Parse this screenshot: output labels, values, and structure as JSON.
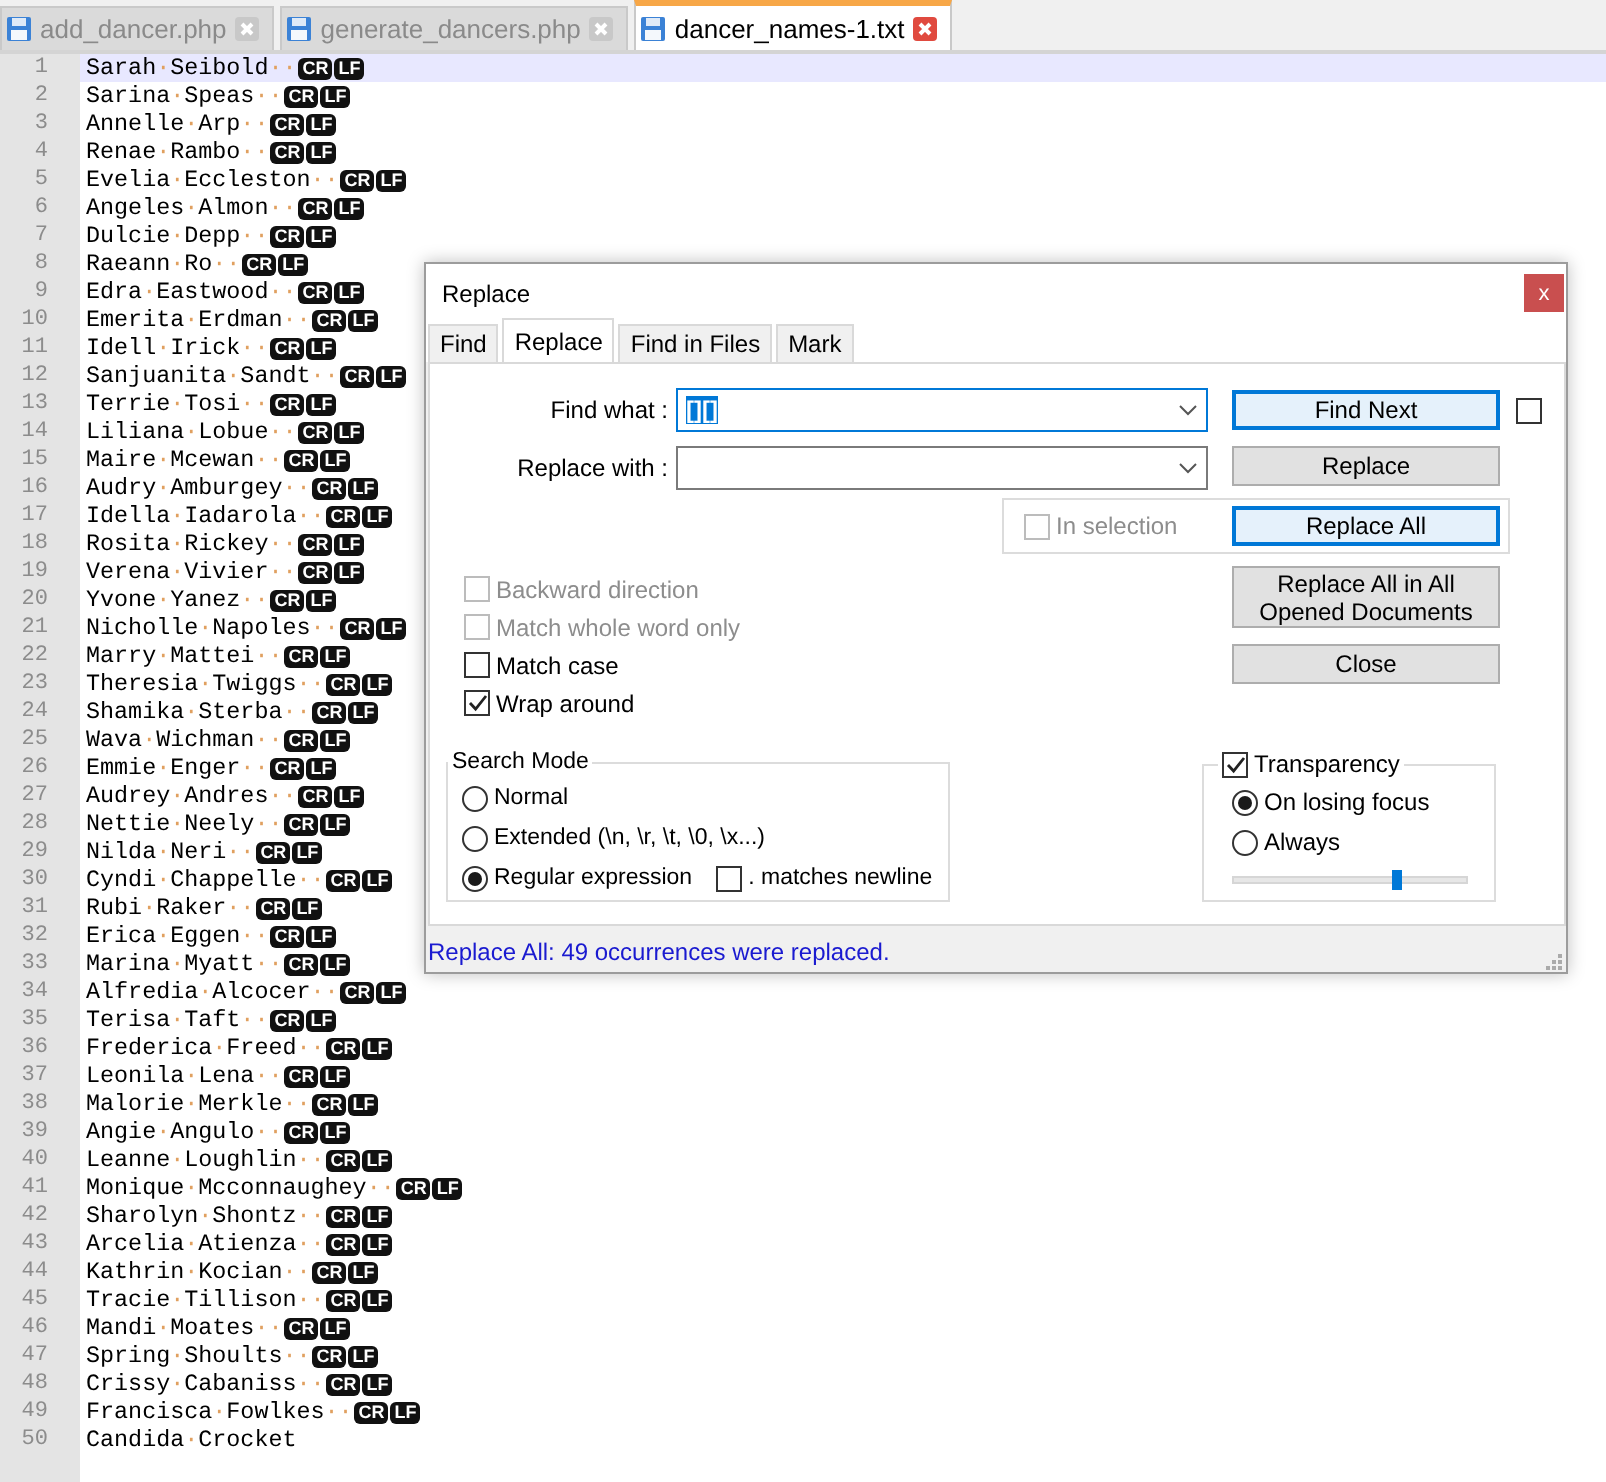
{
  "file_tabs": [
    {
      "label": "add_dancer.php",
      "selected": false
    },
    {
      "label": "generate_dancers.php",
      "selected": false
    },
    {
      "label": "dancer_names-1.txt",
      "selected": true
    }
  ],
  "editor": {
    "lines": [
      {
        "number": "1",
        "text": "Sarah·Seibold··",
        "eol": [
          "CR",
          "LF"
        ],
        "current": true
      },
      {
        "number": "2",
        "text": "Sarina·Speas··",
        "eol": [
          "CR",
          "LF"
        ],
        "current": false
      },
      {
        "number": "3",
        "text": "Annelle·Arp··",
        "eol": [
          "CR",
          "LF"
        ],
        "current": false
      },
      {
        "number": "4",
        "text": "Renae·Rambo··",
        "eol": [
          "CR",
          "LF"
        ],
        "current": false
      },
      {
        "number": "5",
        "text": "Evelia·Eccleston··",
        "eol": [
          "CR",
          "LF"
        ],
        "current": false
      },
      {
        "number": "6",
        "text": "Angeles·Almon··",
        "eol": [
          "CR",
          "LF"
        ],
        "current": false
      },
      {
        "number": "7",
        "text": "Dulcie·Depp··",
        "eol": [
          "CR",
          "LF"
        ],
        "current": false
      },
      {
        "number": "8",
        "text": "Raeann·Ro··",
        "eol": [
          "CR",
          "LF"
        ],
        "current": false
      },
      {
        "number": "9",
        "text": "Edra·Eastwood··",
        "eol": [
          "CR",
          "LF"
        ],
        "current": false
      },
      {
        "number": "10",
        "text": "Emerita·Erdman··",
        "eol": [
          "CR",
          "LF"
        ],
        "current": false
      },
      {
        "number": "11",
        "text": "Idell·Irick··",
        "eol": [
          "CR",
          "LF"
        ],
        "current": false
      },
      {
        "number": "12",
        "text": "Sanjuanita·Sandt··",
        "eol": [
          "CR",
          "LF"
        ],
        "current": false
      },
      {
        "number": "13",
        "text": "Terrie·Tosi··",
        "eol": [
          "CR",
          "LF"
        ],
        "current": false
      },
      {
        "number": "14",
        "text": "Liliana·Lobue··",
        "eol": [
          "CR",
          "LF"
        ],
        "current": false
      },
      {
        "number": "15",
        "text": "Maire·Mcewan··",
        "eol": [
          "CR",
          "LF"
        ],
        "current": false
      },
      {
        "number": "16",
        "text": "Audry·Amburgey··",
        "eol": [
          "CR",
          "LF"
        ],
        "current": false
      },
      {
        "number": "17",
        "text": "Idella·Iadarola··",
        "eol": [
          "CR",
          "LF"
        ],
        "current": false
      },
      {
        "number": "18",
        "text": "Rosita·Rickey··",
        "eol": [
          "CR",
          "LF"
        ],
        "current": false
      },
      {
        "number": "19",
        "text": "Verena·Vivier··",
        "eol": [
          "CR",
          "LF"
        ],
        "current": false
      },
      {
        "number": "20",
        "text": "Yvone·Yanez··",
        "eol": [
          "CR",
          "LF"
        ],
        "current": false
      },
      {
        "number": "21",
        "text": "Nicholle·Napoles··",
        "eol": [
          "CR",
          "LF"
        ],
        "current": false
      },
      {
        "number": "22",
        "text": "Marry·Mattei··",
        "eol": [
          "CR",
          "LF"
        ],
        "current": false
      },
      {
        "number": "23",
        "text": "Theresia·Twiggs··",
        "eol": [
          "CR",
          "LF"
        ],
        "current": false
      },
      {
        "number": "24",
        "text": "Shamika·Sterba··",
        "eol": [
          "CR",
          "LF"
        ],
        "current": false
      },
      {
        "number": "25",
        "text": "Wava·Wichman··",
        "eol": [
          "CR",
          "LF"
        ],
        "current": false
      },
      {
        "number": "26",
        "text": "Emmie·Enger··",
        "eol": [
          "CR",
          "LF"
        ],
        "current": false
      },
      {
        "number": "27",
        "text": "Audrey·Andres··",
        "eol": [
          "CR",
          "LF"
        ],
        "current": false
      },
      {
        "number": "28",
        "text": "Nettie·Neely··",
        "eol": [
          "CR",
          "LF"
        ],
        "current": false
      },
      {
        "number": "29",
        "text": "Nilda·Neri··",
        "eol": [
          "CR",
          "LF"
        ],
        "current": false
      },
      {
        "number": "30",
        "text": "Cyndi·Chappelle··",
        "eol": [
          "CR",
          "LF"
        ],
        "current": false
      },
      {
        "number": "31",
        "text": "Rubi·Raker··",
        "eol": [
          "CR",
          "LF"
        ],
        "current": false
      },
      {
        "number": "32",
        "text": "Erica·Eggen··",
        "eol": [
          "CR",
          "LF"
        ],
        "current": false
      },
      {
        "number": "33",
        "text": "Marina·Myatt··",
        "eol": [
          "CR",
          "LF"
        ],
        "current": false
      },
      {
        "number": "34",
        "text": "Alfredia·Alcocer··",
        "eol": [
          "CR",
          "LF"
        ],
        "current": false
      },
      {
        "number": "35",
        "text": "Terisa·Taft··",
        "eol": [
          "CR",
          "LF"
        ],
        "current": false
      },
      {
        "number": "36",
        "text": "Frederica·Freed··",
        "eol": [
          "CR",
          "LF"
        ],
        "current": false
      },
      {
        "number": "37",
        "text": "Leonila·Lena··",
        "eol": [
          "CR",
          "LF"
        ],
        "current": false
      },
      {
        "number": "38",
        "text": "Malorie·Merkle··",
        "eol": [
          "CR",
          "LF"
        ],
        "current": false
      },
      {
        "number": "39",
        "text": "Angie·Angulo··",
        "eol": [
          "CR",
          "LF"
        ],
        "current": false
      },
      {
        "number": "40",
        "text": "Leanne·Loughlin··",
        "eol": [
          "CR",
          "LF"
        ],
        "current": false
      },
      {
        "number": "41",
        "text": "Monique·Mcconnaughey··",
        "eol": [
          "CR",
          "LF"
        ],
        "current": false
      },
      {
        "number": "42",
        "text": "Sharolyn·Shontz··",
        "eol": [
          "CR",
          "LF"
        ],
        "current": false
      },
      {
        "number": "43",
        "text": "Arcelia·Atienza··",
        "eol": [
          "CR",
          "LF"
        ],
        "current": false
      },
      {
        "number": "44",
        "text": "Kathrin·Kocian··",
        "eol": [
          "CR",
          "LF"
        ],
        "current": false
      },
      {
        "number": "45",
        "text": "Tracie·Tillison··",
        "eol": [
          "CR",
          "LF"
        ],
        "current": false
      },
      {
        "number": "46",
        "text": "Mandi·Moates··",
        "eol": [
          "CR",
          "LF"
        ],
        "current": false
      },
      {
        "number": "47",
        "text": "Spring·Shoults··",
        "eol": [
          "CR",
          "LF"
        ],
        "current": false
      },
      {
        "number": "48",
        "text": "Crissy·Cabaniss··",
        "eol": [
          "CR",
          "LF"
        ],
        "current": false
      },
      {
        "number": "49",
        "text": "Francisca·Fowlkes··",
        "eol": [
          "CR",
          "LF"
        ],
        "current": false
      },
      {
        "number": "50",
        "text": "Candida·Crocket",
        "current": false
      }
    ]
  },
  "dialog": {
    "title": "Replace",
    "close": "x",
    "tabs": [
      {
        "label": "Find",
        "selected": false
      },
      {
        "label": "Replace",
        "selected": true
      },
      {
        "label": "Find in Files",
        "selected": false
      },
      {
        "label": "Mark",
        "selected": false
      }
    ],
    "find_what": {
      "label": "Find what :",
      "value": "[][]"
    },
    "replace_with": {
      "label": "Replace with :"
    },
    "side_checkbox": {
      "checked": false
    },
    "in_selection": {
      "label": "In selection",
      "checked": false,
      "disabled": true
    },
    "buttons": {
      "find_next": {
        "label": "Find Next",
        "highlighted": true
      },
      "replace": {
        "label": "Replace",
        "highlighted": false
      },
      "replace_all": {
        "label": "Replace All",
        "highlighted": true
      },
      "replace_all_opened": {
        "label": "Replace All in All Opened Documents",
        "highlighted": false
      },
      "close": {
        "label": "Close",
        "highlighted": false
      }
    },
    "options": [
      {
        "label": "Backward direction",
        "checked": false,
        "disabled": true
      },
      {
        "label": "Match whole word only",
        "checked": false,
        "disabled": true
      },
      {
        "label": "Match case",
        "checked": false,
        "disabled": false
      },
      {
        "label": "Wrap around",
        "checked": true,
        "disabled": false
      }
    ],
    "search_mode": {
      "title": "Search Mode",
      "modes": [
        {
          "label": "Normal",
          "selected": false
        },
        {
          "label": "Extended (\\n, \\r, \\t, \\0, \\x...)",
          "selected": false
        },
        {
          "label": "Regular expression",
          "selected": true
        }
      ],
      "dot_matches_newline": {
        "label": ". matches newline",
        "checked": false
      }
    },
    "transparency": {
      "label": "Transparency",
      "checked": true,
      "modes": [
        {
          "label": "On losing focus",
          "selected": true
        },
        {
          "label": "Always",
          "selected": false
        }
      ],
      "level": 0.7
    },
    "status": "Replace All: 49 occurrences were replaced."
  }
}
